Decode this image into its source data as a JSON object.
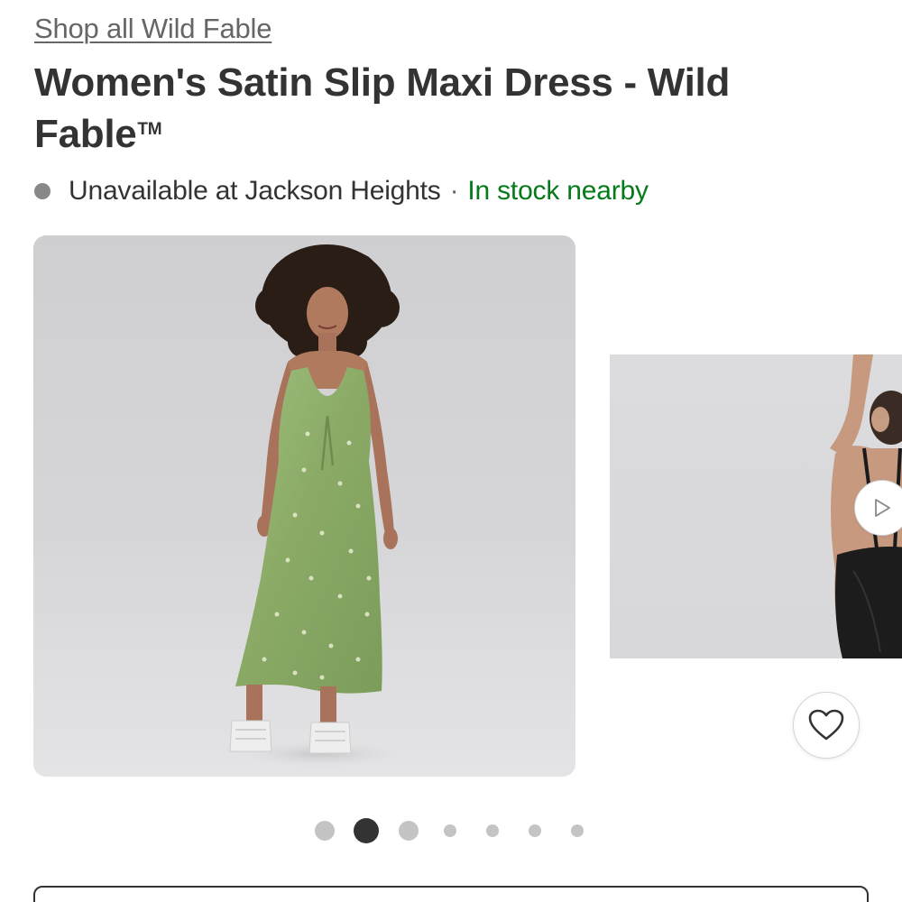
{
  "brand": {
    "shop_all_label": "Shop all Wild Fable"
  },
  "product": {
    "title": "Women's Satin Slip Maxi Dress - Wild Fable",
    "trademark": "TM"
  },
  "availability": {
    "store_status": "Unavailable at Jackson Heights",
    "separator": "·",
    "nearby_status": "In stock nearby",
    "dot_color": "#888888",
    "nearby_color": "#047a19"
  },
  "gallery": {
    "images": [
      {
        "kind": "photo",
        "subject": "model wearing green satin slip maxi dress, front view"
      },
      {
        "kind": "video",
        "subject": "model wearing black slip dress, back view"
      }
    ],
    "dots_total": 7,
    "active_dot_index": 1,
    "icons": {
      "play": "play-icon",
      "favorite": "heart-icon"
    }
  },
  "colors": {
    "text": "#333333",
    "muted": "#666666",
    "dot_inactive": "#c4c4c4",
    "dot_active": "#333333"
  }
}
